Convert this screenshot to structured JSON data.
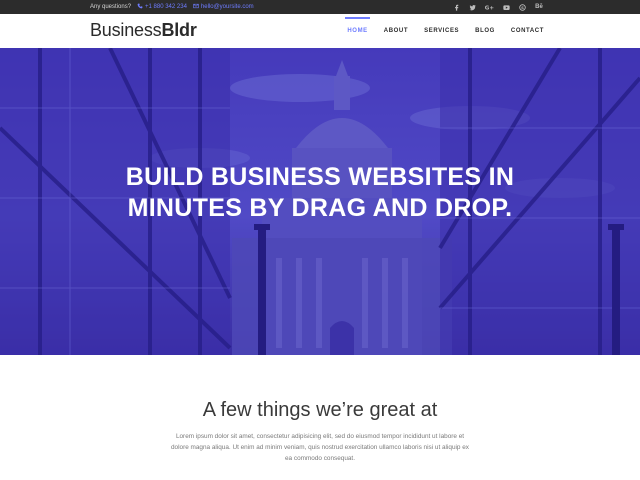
{
  "topbar": {
    "question": "Any questions?",
    "phone": "+1 880 342 234",
    "email": "hello@yoursite.com",
    "socials": [
      "facebook-icon",
      "twitter-icon",
      "google-plus-icon",
      "youtube-icon",
      "skype-icon",
      "behance-icon"
    ],
    "behance_label": "Bē"
  },
  "header": {
    "logo_regular": "Business",
    "logo_bold": "Bldr",
    "nav": [
      "HOME",
      "ABOUT",
      "SERVICES",
      "BLOG",
      "CONTACT"
    ],
    "active_nav": "HOME"
  },
  "hero": {
    "title": "BUILD BUSINESS WEBSITES IN\nMINUTES BY DRAG AND DROP."
  },
  "intro": {
    "heading": "A few things we’re great at",
    "body": "Lorem ipsum dolor sit amet, consectetur adipisicing elit, sed do eiusmod tempor incididunt ut labore et dolore magna aliqua. Ut enim ad minim veniam, quis nostrud exercitation ullamco laboris nisi ut aliquip ex ea commodo consequat."
  },
  "colors": {
    "accent": "#6e7cff",
    "hero_overlay": "#3c2fa9",
    "topbar": "#2c2c2c"
  }
}
